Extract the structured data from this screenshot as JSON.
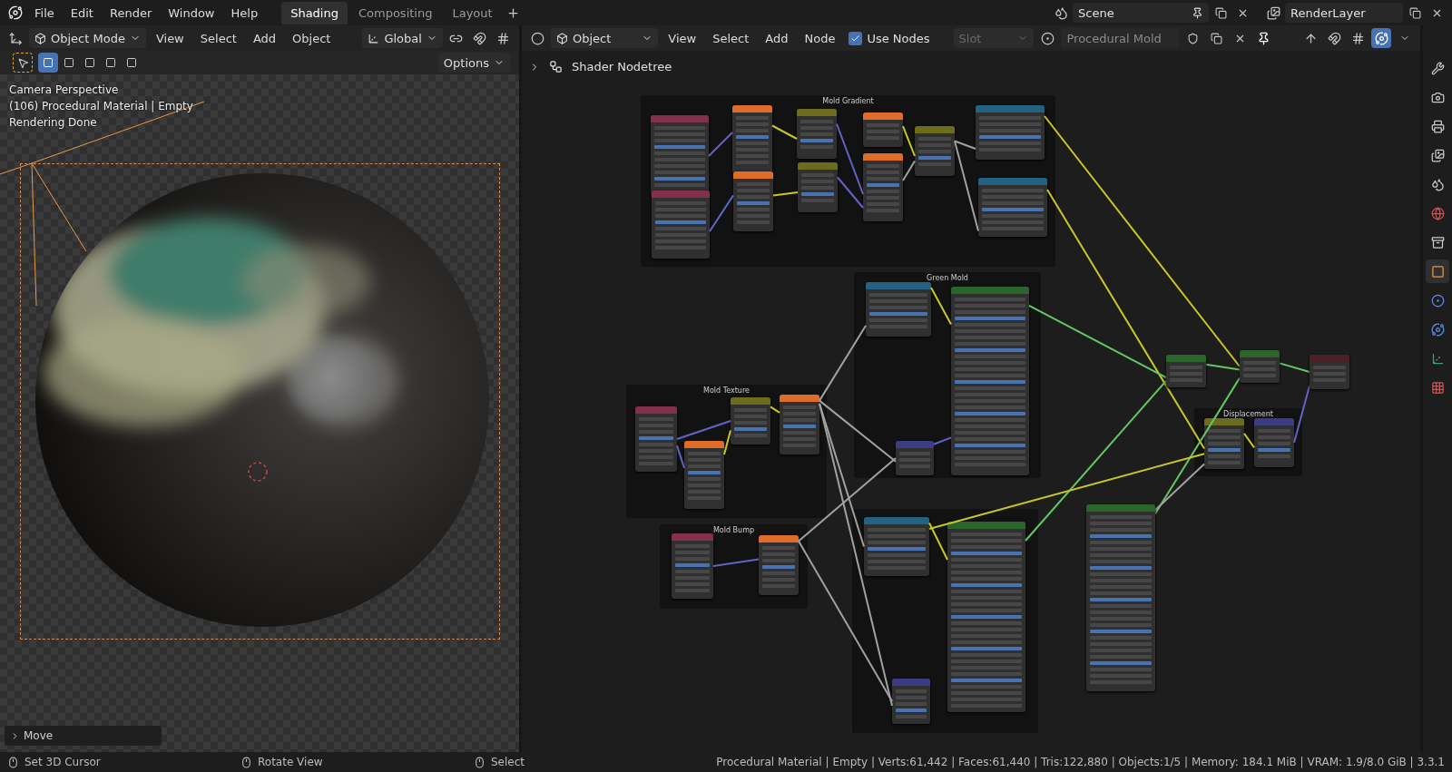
{
  "top_bar": {
    "menus": [
      "File",
      "Edit",
      "Render",
      "Window",
      "Help"
    ],
    "workspaces": [
      {
        "label": "Shading",
        "selected": true
      },
      {
        "label": "Compositing",
        "selected": false
      },
      {
        "label": "Layout",
        "selected": false
      }
    ],
    "scene": "Scene",
    "view_layer": "RenderLayer"
  },
  "viewport": {
    "mode": "Object Mode",
    "menus": [
      "View",
      "Select",
      "Add",
      "Object"
    ],
    "orientation": "Global",
    "select_modes": [
      {
        "selected": true
      },
      {
        "selected": false
      },
      {
        "selected": false
      },
      {
        "selected": false
      },
      {
        "selected": false
      }
    ],
    "options": "Options",
    "overlay_lines": [
      "Camera Perspective",
      "(106) Procedural Material | Empty",
      "Rendering Done"
    ],
    "last_operator": "Move"
  },
  "node_editor": {
    "type": "Object",
    "menus": [
      "View",
      "Select",
      "Add",
      "Node"
    ],
    "use_nodes": {
      "label": "Use Nodes",
      "checked": true
    },
    "slot": {
      "label": "Slot",
      "disabled": true
    },
    "material": "Procedural Mold",
    "breadcrumb": "Shader Nodetree",
    "frames": [
      {
        "title": "Mold Gradient",
        "nodes": [
          {
            "kind": "input"
          },
          {
            "kind": "input"
          },
          {
            "kind": "texture"
          },
          {
            "kind": "texture"
          },
          {
            "kind": "color"
          },
          {
            "kind": "color"
          },
          {
            "kind": "texture"
          },
          {
            "kind": "texture"
          },
          {
            "kind": "color"
          },
          {
            "kind": "converter"
          },
          {
            "kind": "converter"
          }
        ]
      },
      {
        "title": "Green Mold",
        "nodes": [
          {
            "kind": "converter"
          },
          {
            "kind": "shader"
          },
          {
            "kind": "vector"
          }
        ]
      },
      {
        "title": "Mold Texture",
        "nodes": [
          {
            "kind": "input"
          },
          {
            "kind": "color"
          },
          {
            "kind": "texture"
          },
          {
            "kind": "texture"
          }
        ]
      },
      {
        "title": "Mold Bump",
        "nodes": [
          {
            "kind": "input"
          },
          {
            "kind": "texture"
          }
        ]
      },
      {
        "nodes": [
          {
            "kind": "converter"
          },
          {
            "kind": "shader"
          },
          {
            "kind": "vector"
          }
        ]
      },
      {
        "title": "Displacement",
        "nodes": [
          {
            "kind": "color"
          },
          {
            "kind": "vector"
          }
        ]
      }
    ],
    "loose_nodes": [
      {
        "kind": "shader"
      },
      {
        "kind": "shader"
      },
      {
        "kind": "shader"
      },
      {
        "kind": "output"
      }
    ]
  },
  "properties_tabs": [
    {
      "selected": false
    },
    {
      "selected": false
    },
    {
      "selected": false
    },
    {
      "selected": false
    },
    {
      "selected": false
    },
    {
      "selected": false
    },
    {
      "selected": false
    },
    {
      "selected": true
    },
    {
      "selected": false
    },
    {
      "selected": false
    },
    {
      "selected": false
    },
    {
      "selected": false
    }
  ],
  "status_bar": {
    "hints": [
      "Set 3D Cursor",
      "Rotate View",
      "Select"
    ],
    "stats": "Procedural Material | Empty | Verts:61,442 | Faces:61,440 | Tris:122,880 | Objects:1/5 | Memory: 184.1 MiB | VRAM: 1.9/8.0 GiB | 3.3.1"
  }
}
